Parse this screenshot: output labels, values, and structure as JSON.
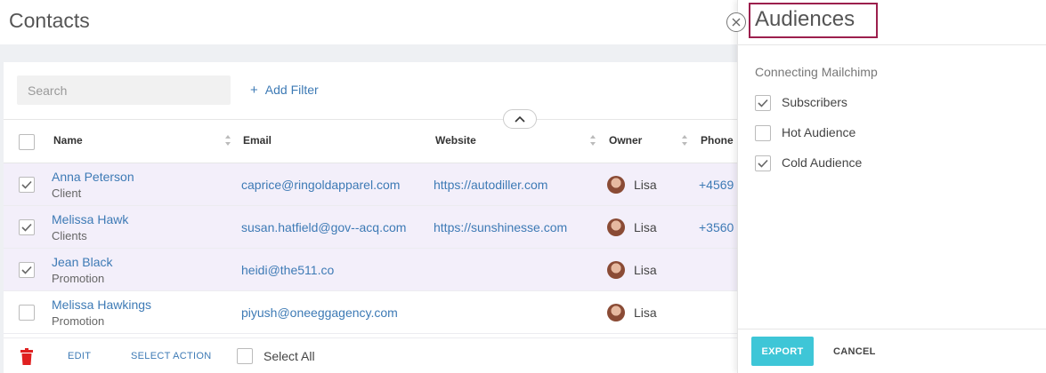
{
  "page": {
    "title": "Contacts"
  },
  "toolbar": {
    "search_placeholder": "Search",
    "add_filter_label": "Add Filter"
  },
  "table": {
    "headers": {
      "name": "Name",
      "email": "Email",
      "website": "Website",
      "owner": "Owner",
      "phone": "Phone"
    },
    "rows": [
      {
        "name": "Anna Peterson",
        "type": "Client",
        "email": "caprice@ringoldapparel.com",
        "website": "https://autodiller.com",
        "owner": "Lisa",
        "phone": "+4569",
        "checked": true
      },
      {
        "name": "Melissa Hawk",
        "type": "Clients",
        "email": "susan.hatfield@gov--acq.com",
        "website": "https://sunshinesse.com",
        "owner": "Lisa",
        "phone": "+3560",
        "checked": true
      },
      {
        "name": "Jean Black",
        "type": "Promotion",
        "email": "heidi@the511.co",
        "website": "",
        "owner": "Lisa",
        "phone": "",
        "checked": true
      },
      {
        "name": "Melissa Hawkings",
        "type": "Promotion",
        "email": "piyush@oneeggagency.com",
        "website": "",
        "owner": "Lisa",
        "phone": "",
        "checked": false
      }
    ]
  },
  "footer": {
    "edit_label": "EDIT",
    "select_action_label": "SELECT ACTION",
    "select_all_label": "Select All"
  },
  "panel": {
    "title": "Audiences",
    "subtitle": "Connecting Mailchimp",
    "audiences": [
      {
        "label": "Subscribers",
        "checked": true
      },
      {
        "label": "Hot Audience",
        "checked": false
      },
      {
        "label": "Cold Audience",
        "checked": true
      }
    ],
    "export_label": "EXPORT",
    "cancel_label": "CANCEL"
  },
  "colors": {
    "accent": "#3d7ab5",
    "export": "#3ec6d7",
    "selected_row": "#f3effa",
    "title_outline": "#9c1f4d",
    "trash": "#e02020"
  }
}
